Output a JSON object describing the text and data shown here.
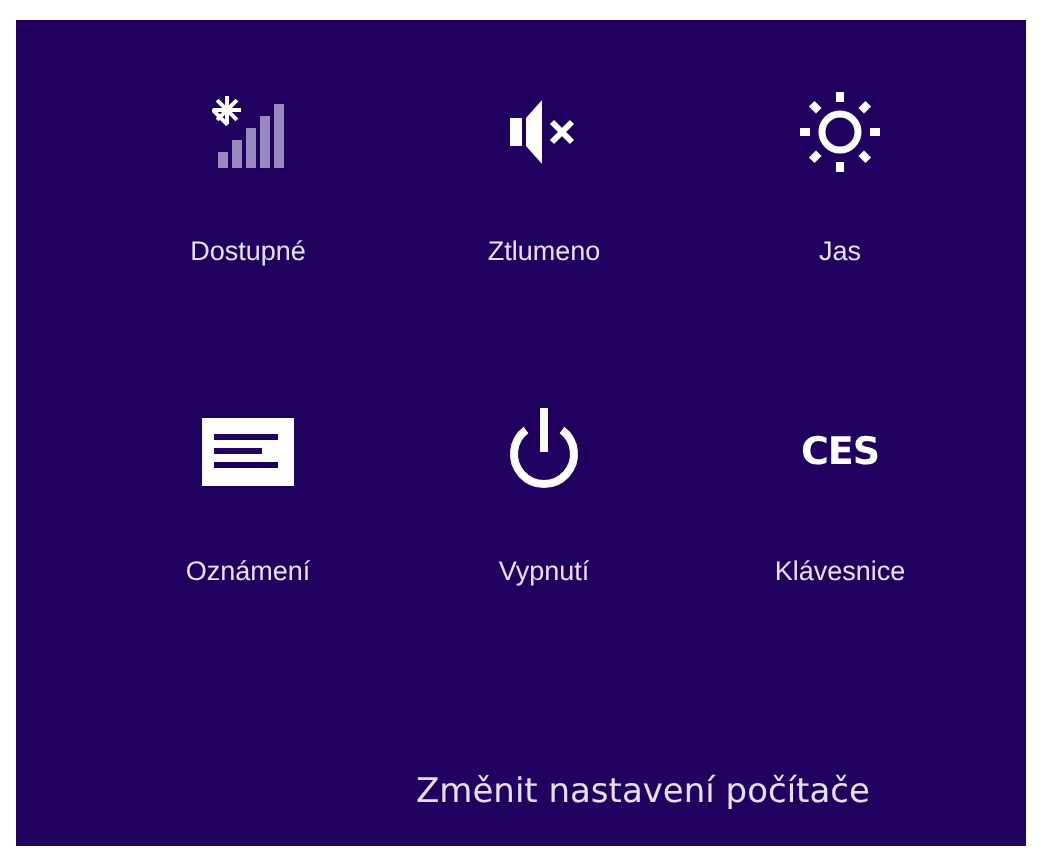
{
  "tiles": [
    {
      "kind": "network",
      "label": "Dostupné"
    },
    {
      "kind": "volume",
      "label": "Ztlumeno"
    },
    {
      "kind": "brightness",
      "label": "Jas"
    },
    {
      "kind": "notifications",
      "label": "Oznámení"
    },
    {
      "kind": "power",
      "label": "Vypnutí"
    },
    {
      "kind": "keyboard",
      "icon_text": "CES",
      "label": "Klávesnice"
    }
  ],
  "link": "Změnit nastavení počítače"
}
